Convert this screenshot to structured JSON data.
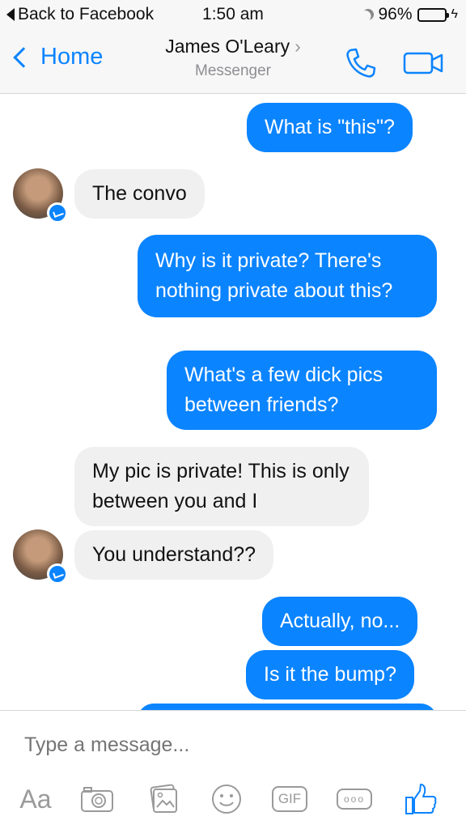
{
  "status_bar": {
    "back_label": "Back to Facebook",
    "time": "1:50 am",
    "battery": "96%",
    "battery_level": 0.96,
    "battery_color": "#2fbf2f"
  },
  "nav": {
    "back_label": "Home",
    "contact_name": "James O'Leary",
    "subtitle": "Messenger",
    "call_icon": "phone-icon",
    "video_icon": "video-camera-icon",
    "accent_color": "#0b84ff"
  },
  "messages": [
    {
      "direction": "out",
      "text": "What is \"this\"?"
    },
    {
      "direction": "in",
      "text": "The convo"
    },
    {
      "direction": "out",
      "text": "Why is it private? There's nothing private about this?"
    },
    {
      "direction": "out",
      "text": "What's a few dick pics between friends?"
    },
    {
      "direction": "in",
      "text": "My pic is private!  This is only between you and I"
    },
    {
      "direction": "in",
      "text": "You understand??"
    },
    {
      "direction": "out",
      "text": "Actually, no..."
    },
    {
      "direction": "out",
      "text": "Is it the bump?"
    }
  ],
  "composer": {
    "placeholder": "Type a message...",
    "text_button": "Aa",
    "gif_button": "GIF",
    "more_button": "ooo",
    "icons": [
      "text-format-icon",
      "camera-icon",
      "photo-gallery-icon",
      "emoji-icon",
      "gif-icon",
      "more-icon",
      "thumbs-up-icon"
    ]
  }
}
